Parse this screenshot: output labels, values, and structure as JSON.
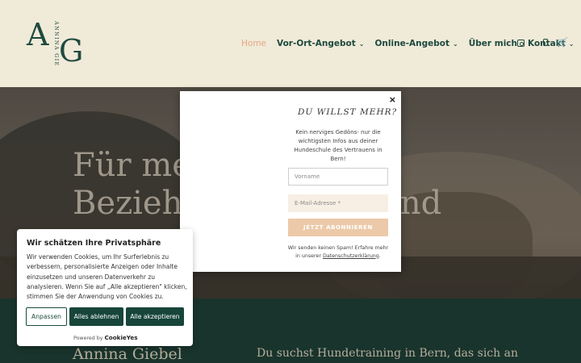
{
  "header": {
    "logo_a": "A",
    "logo_g": "G",
    "logo_text": "ANNINA GIEBEL",
    "nav": [
      {
        "label": "Home",
        "active": true,
        "dropdown": false
      },
      {
        "label": "Vor-Ort-Angebot",
        "active": false,
        "dropdown": true
      },
      {
        "label": "Online-Angebot",
        "active": false,
        "dropdown": true
      },
      {
        "label": "Über mich",
        "active": false,
        "dropdown": false
      },
      {
        "label": "Kontakt",
        "active": false,
        "dropdown": true
      }
    ],
    "icons": [
      "instagram-icon",
      "search-icon",
      "cart-icon"
    ]
  },
  "hero": {
    "title_line1": "Für mel",
    "title_line2": "Beziehu",
    "title_tail": "und"
  },
  "dark_section": {
    "name": "Annina Giebel",
    "lead": "Du suchst Hundetraining in Bern, das sich an"
  },
  "popup": {
    "close": "×",
    "heading": "DU WILLST MEHR?",
    "description": "Kein nerviges Gedöns- nur die wichtigsten Infos aus deiner Hundeschule des Vertrauens in Bern!",
    "firstname_placeholder": "Vorname",
    "email_placeholder": "E-Mail-Adresse *",
    "submit": "JETZT ABONNIEREN",
    "note_prefix": "Wir senden keinen Spam! Erfahre mehr in unserer ",
    "note_link": "Datenschutzerklärung",
    "note_suffix": "."
  },
  "cookie": {
    "title": "Wir schätzen Ihre Privatsphäre",
    "text": "Wir verwenden Cookies, um Ihr Surferlebnis zu verbessern, personalisierte Anzeigen oder Inhalte einzusetzen und unseren Datenverkehr zu analysieren. Wenn Sie auf „Alle akzeptieren\" klicken, stimmen Sie der Anwendung von Cookies zu.",
    "btn_customize": "Anpassen",
    "btn_reject": "Alles ablehnen",
    "btn_accept": "Alle akzeptieren",
    "powered_by": "Powered by",
    "brand": "CookieYes"
  },
  "colors": {
    "brand_green": "#17453a",
    "accent_peach": "#e9a785",
    "header_bg": "#f0ead9"
  }
}
